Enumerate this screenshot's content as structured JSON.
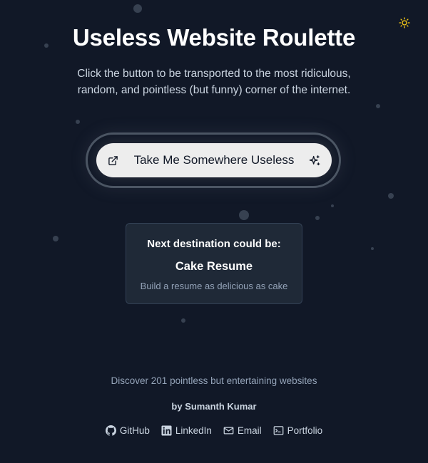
{
  "theme_toggle": {
    "icon": "sun-icon",
    "color": "#facc15"
  },
  "hero": {
    "title": "Useless Website Roulette",
    "subtitle": "Click the button to be transported to the most ridiculous, random, and pointless (but funny) corner of the internet."
  },
  "cta": {
    "label": "Take Me Somewhere Useless",
    "left_icon": "external-link-icon",
    "right_icon": "sparkles-icon"
  },
  "preview": {
    "heading": "Next destination could be:",
    "site_name": "Cake Resume",
    "description": "Build a resume as delicious as cake"
  },
  "footer": {
    "discover": "Discover 201 pointless but entertaining websites",
    "byline": "by Sumanth Kumar",
    "links": [
      {
        "label": "GitHub",
        "icon": "github-icon"
      },
      {
        "label": "LinkedIn",
        "icon": "linkedin-icon"
      },
      {
        "label": "Email",
        "icon": "mail-icon"
      },
      {
        "label": "Portfolio",
        "icon": "terminal-icon"
      }
    ]
  },
  "colors": {
    "background": "#111827",
    "card_background": "#1f2937",
    "button_background": "#ededed",
    "muted_text": "#94a3b8"
  }
}
